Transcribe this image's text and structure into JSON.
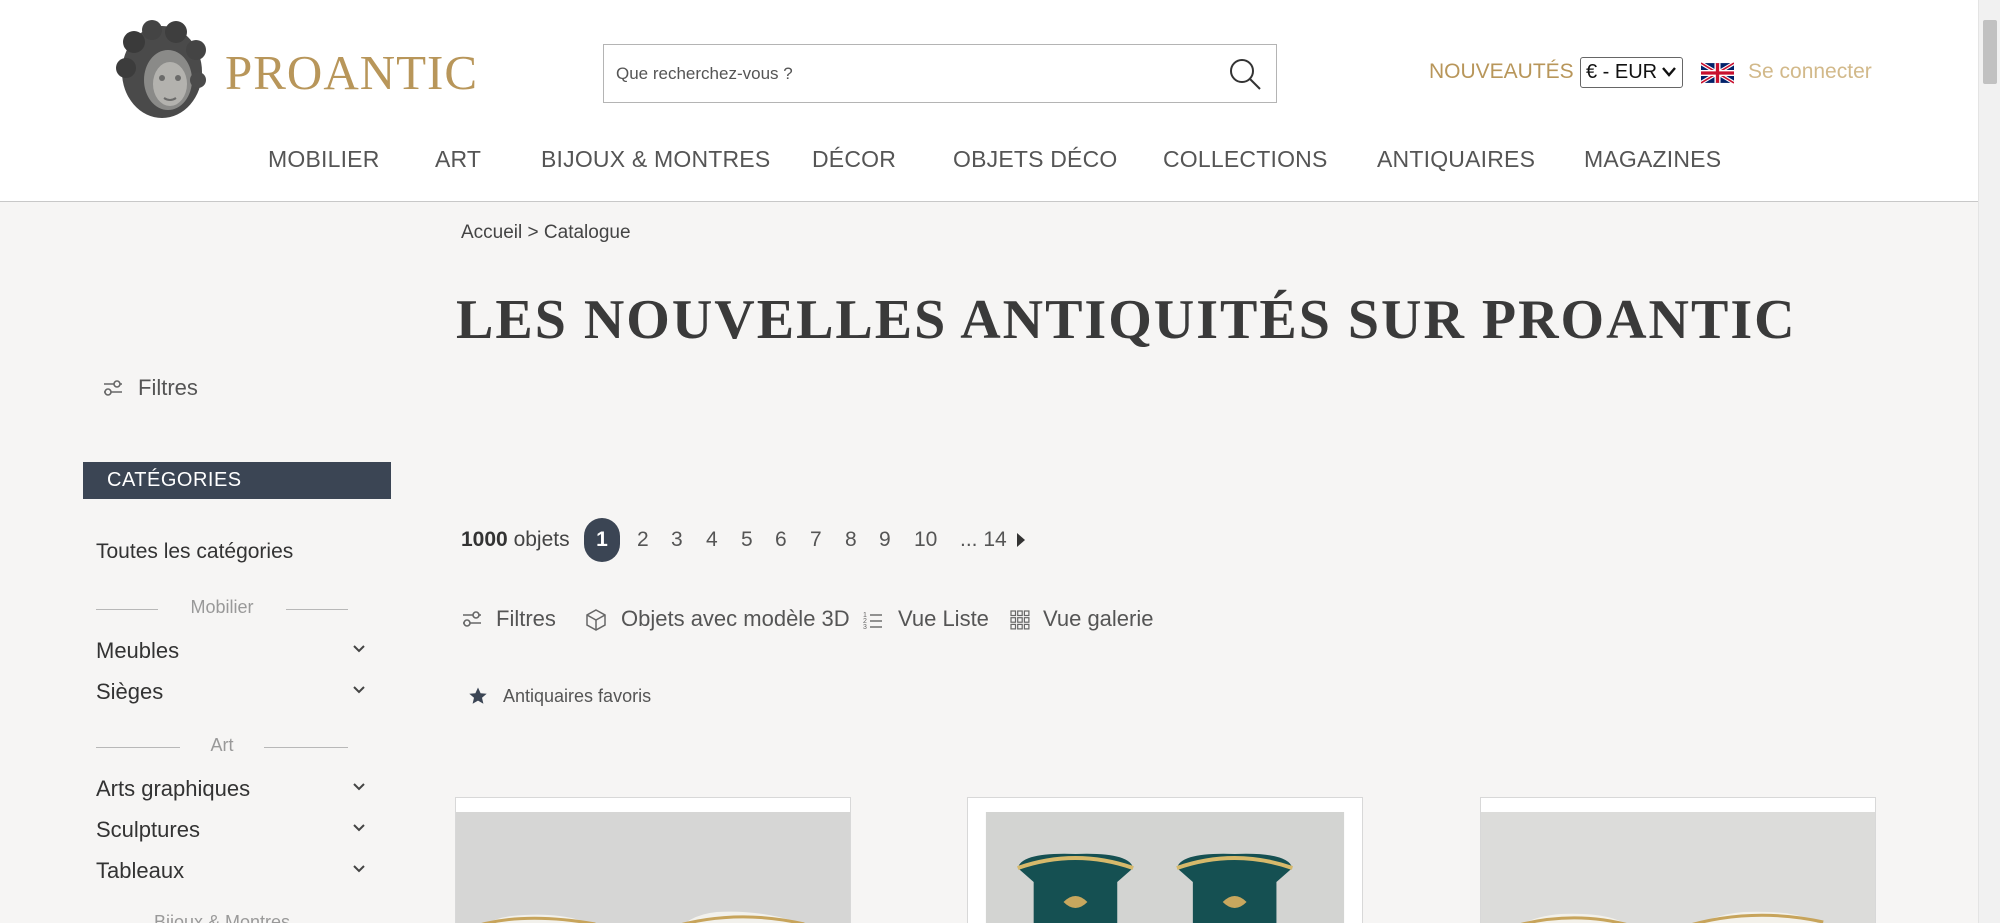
{
  "brand": {
    "name": "PROANTIC"
  },
  "search": {
    "placeholder": "Que recherchez-vous ?"
  },
  "header": {
    "new_label": "NOUVEAUTÉS",
    "currency": "€ - EUR",
    "login_label": "Se connecter"
  },
  "nav": [
    {
      "label": "MOBILIER"
    },
    {
      "label": "ART"
    },
    {
      "label": "BIJOUX & MONTRES"
    },
    {
      "label": "DÉCOR"
    },
    {
      "label": "OBJETS DÉCO"
    },
    {
      "label": "COLLECTIONS"
    },
    {
      "label": "ANTIQUAIRES"
    },
    {
      "label": "MAGAZINES"
    }
  ],
  "breadcrumb": "Accueil > Catalogue",
  "page_title": "LES NOUVELLES ANTIQUITÉS SUR PROANTIC",
  "sidebar": {
    "filters_label": "Filtres",
    "categories_header": "CATÉGORIES",
    "all_categories": "Toutes les catégories",
    "sections": [
      {
        "title": "Mobilier",
        "items": [
          {
            "label": "Meubles"
          },
          {
            "label": "Sièges"
          }
        ]
      },
      {
        "title": "Art",
        "items": [
          {
            "label": "Arts graphiques"
          },
          {
            "label": "Sculptures"
          },
          {
            "label": "Tableaux"
          }
        ]
      },
      {
        "title": "Bijoux & Montres"
      }
    ]
  },
  "results": {
    "count_number": "1000",
    "count_label": "objets",
    "pages": [
      "1",
      "2",
      "3",
      "4",
      "5",
      "6",
      "7",
      "8",
      "9",
      "10",
      "... 14"
    ],
    "current_page": "1"
  },
  "toolbar": {
    "filters": "Filtres",
    "model3d": "Objets avec modèle 3D",
    "list_view": "Vue Liste",
    "gallery_view": "Vue galerie"
  },
  "favorites_label": "Antiquaires favoris",
  "colors": {
    "accent_gold": "#b8965a",
    "dark_slate": "#3b4554",
    "page_bg": "#f6f5f4"
  }
}
